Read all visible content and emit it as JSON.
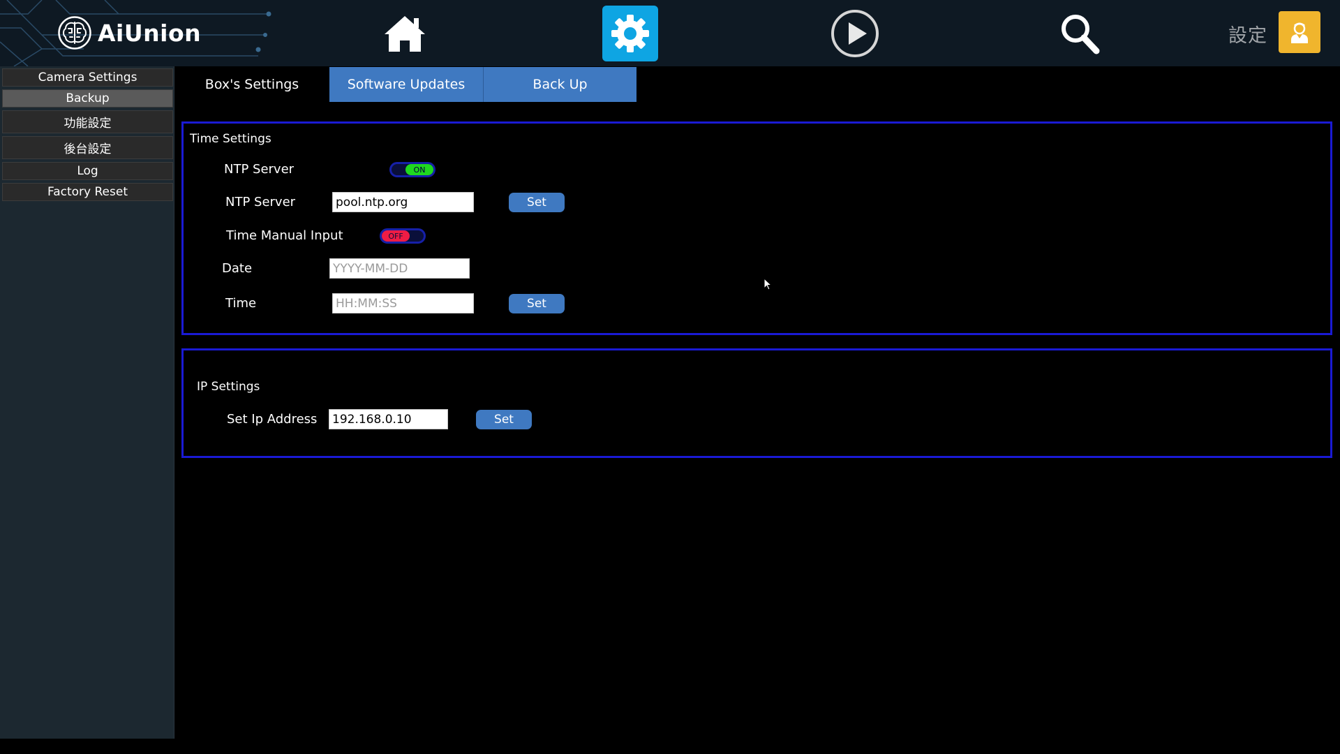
{
  "header": {
    "brand": "AiUnion",
    "user_label": "設定",
    "icons": [
      "home-icon",
      "gear-icon",
      "play-icon",
      "search-icon",
      "user-icon"
    ]
  },
  "sidebar": {
    "items": [
      {
        "label": "Camera Settings"
      },
      {
        "label": "Backup",
        "active": true
      },
      {
        "label": "功能設定"
      },
      {
        "label": "後台設定"
      },
      {
        "label": "Log"
      },
      {
        "label": "Factory Reset"
      }
    ]
  },
  "tabs": [
    {
      "label": "Box's Settings",
      "active": true
    },
    {
      "label": "Software Updates"
    },
    {
      "label": "Back Up"
    }
  ],
  "time_settings": {
    "title": "Time Settings",
    "ntp_toggle": {
      "label": "NTP Server",
      "state": "ON"
    },
    "ntp_server": {
      "label": "NTP Server",
      "value": "pool.ntp.org",
      "button": "Set"
    },
    "manual_toggle": {
      "label": "Time Manual Input",
      "state": "OFF"
    },
    "date": {
      "label": "Date",
      "placeholder": "YYYY-MM-DD",
      "value": ""
    },
    "time": {
      "label": "Time",
      "placeholder": "HH:MM:SS",
      "value": "",
      "button": "Set"
    }
  },
  "ip_settings": {
    "title": "IP Settings",
    "ip": {
      "label": "Set Ip Address",
      "value": "192.168.0.10",
      "button": "Set"
    }
  },
  "colors": {
    "accent_blue": "#3f79c1",
    "panel_border": "#1a1ad4",
    "toggle_on": "#1fd81f",
    "toggle_off": "#ee1c45",
    "settings_active": "#0ea5e3",
    "user_button": "#f0b52d"
  }
}
